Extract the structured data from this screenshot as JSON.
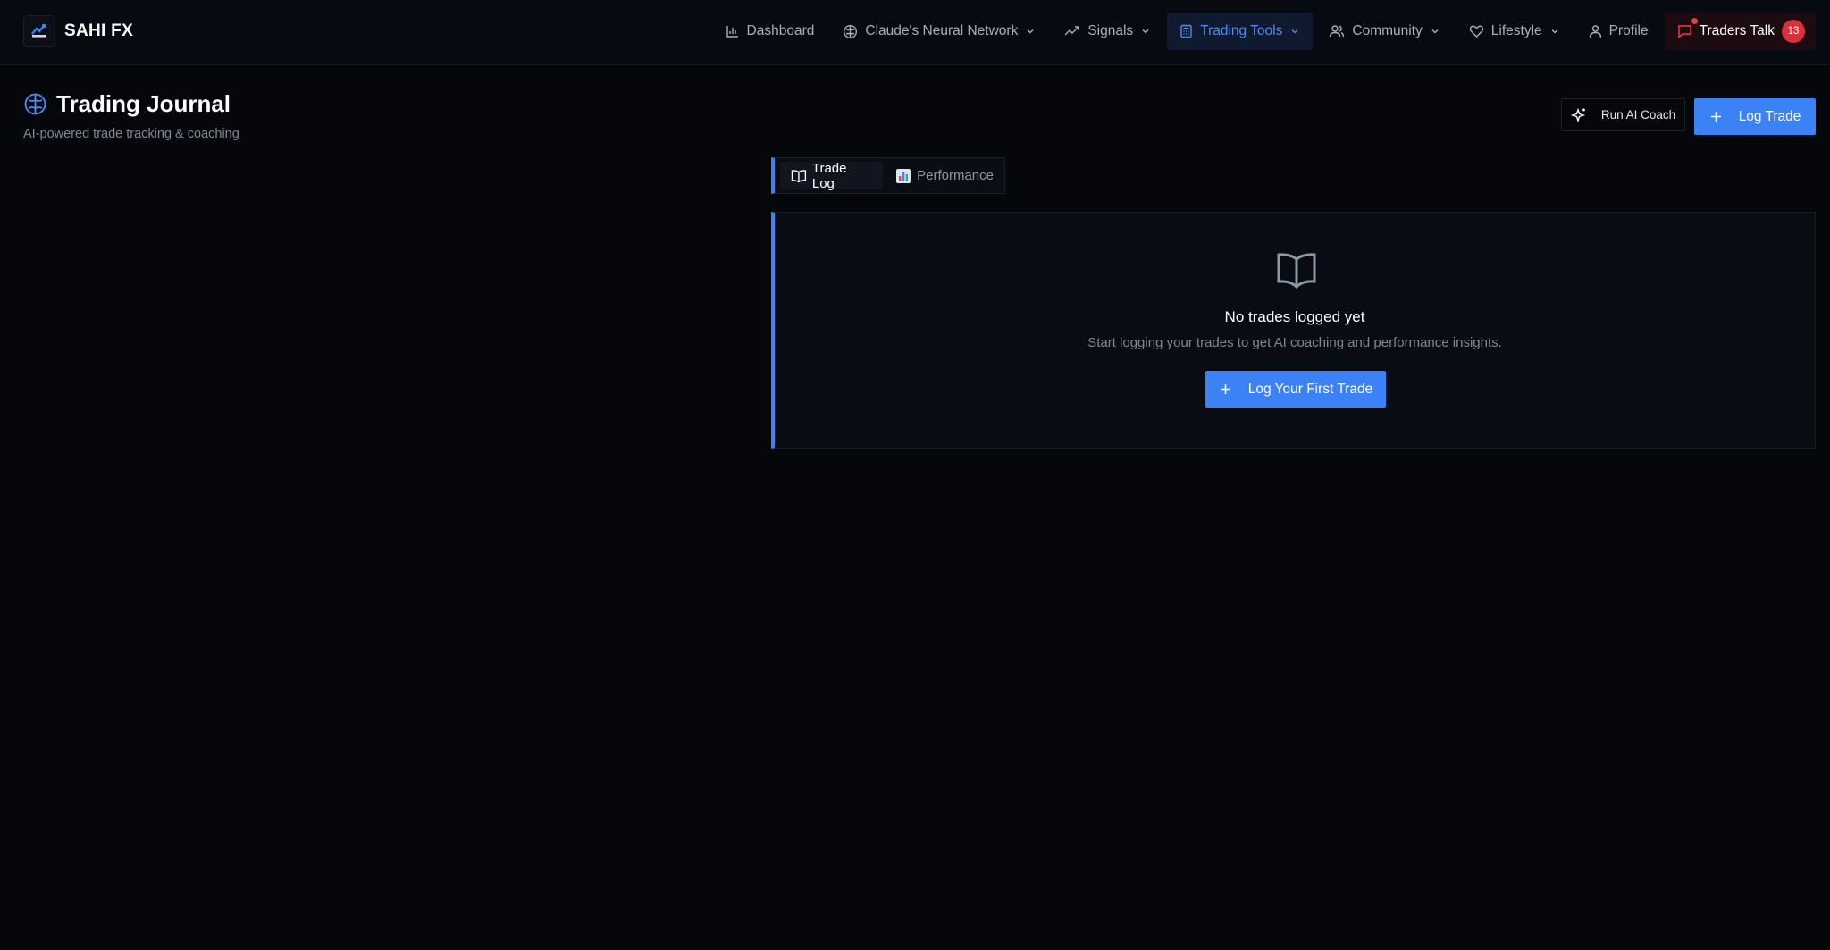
{
  "app": {
    "name": "SAHI FX",
    "logo_text": "SAHI FX"
  },
  "nav": {
    "items": [
      {
        "label": "Dashboard",
        "icon": "bar-chart-icon",
        "dropdown": false
      },
      {
        "label": "Claude's Neural Network",
        "icon": "brain-icon",
        "dropdown": true
      },
      {
        "label": "Signals",
        "icon": "trending-up-icon",
        "dropdown": true
      },
      {
        "label": "Trading Tools",
        "icon": "calculator-icon",
        "dropdown": true,
        "active": true
      },
      {
        "label": "Community",
        "icon": "users-icon",
        "dropdown": true
      },
      {
        "label": "Lifestyle",
        "icon": "heart-icon",
        "dropdown": true
      },
      {
        "label": "Profile",
        "icon": "user-icon",
        "dropdown": false
      }
    ],
    "talk": {
      "label": "Traders Talk",
      "icon": "message-icon",
      "count": "13"
    }
  },
  "header": {
    "title": "Trading Journal",
    "subtitle": "AI-powered trade tracking & coaching",
    "coach_label": "Run AI Coach",
    "log_label": "Log Trade"
  },
  "tabs": [
    {
      "label": "Trade Log",
      "icon": "book-open-icon",
      "active": true
    },
    {
      "label": "Performance",
      "icon": "chart-emoji-icon",
      "active": false
    }
  ],
  "empty_state": {
    "title": "No trades logged yet",
    "description": "Start logging your trades to get AI coaching and performance insights.",
    "button_label": "Log Your First Trade"
  },
  "colors": {
    "accent": "#3b82f6",
    "background": "#05070b",
    "badge": "#d9313c"
  }
}
